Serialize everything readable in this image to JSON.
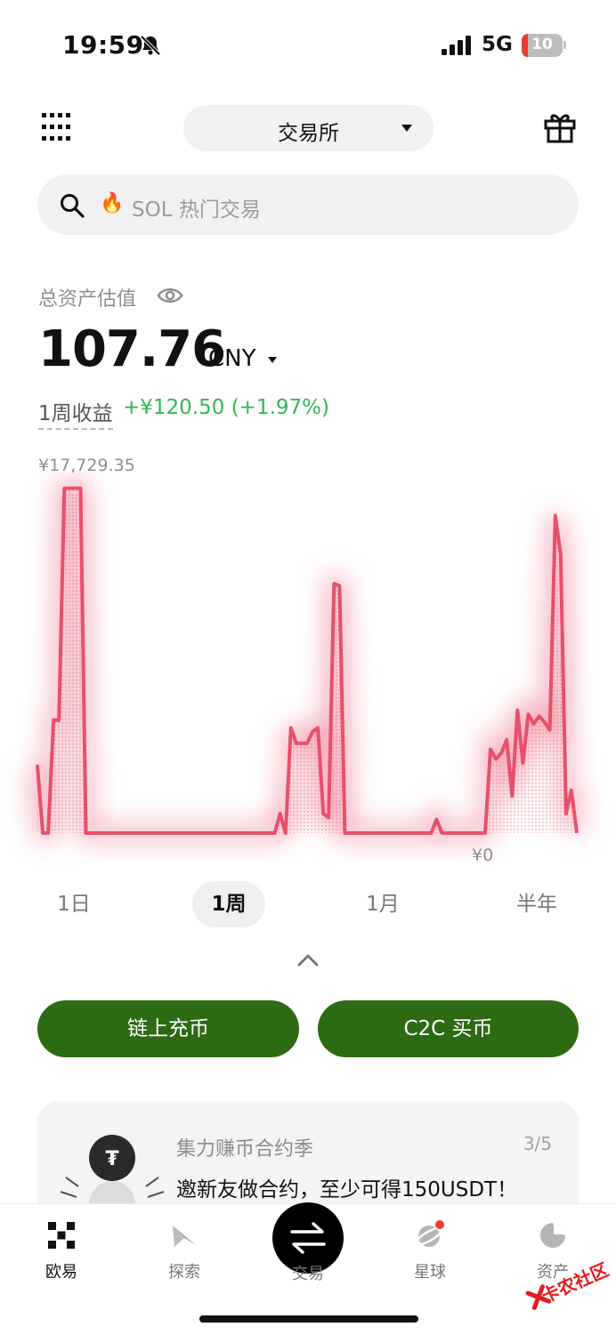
{
  "status_bar": {
    "time": "19:59",
    "network": "5G",
    "battery_level": "10"
  },
  "header": {
    "exchange_label": "交易所"
  },
  "search": {
    "placeholder": "SOL 热门交易",
    "hot_emoji": "🔥"
  },
  "assets": {
    "label": "总资产估值",
    "value": "107.76",
    "currency": "CNY",
    "pnl_label": "1周收益",
    "pnl_value": "+¥120.50 (+1.97%)"
  },
  "chart_data": {
    "type": "line",
    "max_label": "¥17,729.35",
    "min_label": "¥0",
    "ylim": [
      0,
      17729.35
    ],
    "color": "#e8506a",
    "x": [
      0,
      1,
      2,
      3,
      4,
      5,
      6,
      7,
      8,
      9,
      10,
      11,
      12,
      13,
      14,
      15,
      16,
      17,
      18,
      19,
      20,
      21,
      22,
      23,
      24,
      25,
      26,
      27,
      28,
      29,
      30,
      31,
      32,
      33,
      34,
      35,
      36,
      37,
      38,
      39,
      40,
      41,
      42,
      43,
      44,
      45,
      46,
      47,
      48,
      49,
      50,
      51,
      52,
      53,
      54,
      55,
      56,
      57,
      58,
      59,
      60,
      61,
      62,
      63,
      64,
      65,
      66,
      67,
      68,
      69,
      70,
      71,
      72,
      73,
      74,
      75,
      76,
      77,
      78,
      79,
      80,
      81,
      82,
      83,
      84,
      85,
      86,
      87,
      88,
      89,
      90,
      91,
      92,
      93,
      94,
      95,
      96,
      97,
      98,
      99,
      100
    ],
    "values": [
      3500,
      0,
      0,
      5800,
      5800,
      17700,
      17700,
      17700,
      17700,
      0,
      0,
      0,
      0,
      0,
      0,
      0,
      0,
      0,
      0,
      0,
      0,
      0,
      0,
      0,
      0,
      0,
      0,
      0,
      0,
      0,
      0,
      0,
      0,
      0,
      0,
      0,
      0,
      0,
      0,
      0,
      0,
      0,
      0,
      0,
      0,
      1000,
      0,
      5400,
      4600,
      4600,
      4600,
      5200,
      5400,
      1000,
      800,
      12800,
      12700,
      0,
      0,
      0,
      0,
      0,
      0,
      0,
      0,
      0,
      0,
      0,
      0,
      0,
      0,
      0,
      0,
      0,
      700,
      0,
      0,
      0,
      0,
      0,
      0,
      0,
      0,
      0,
      4300,
      3800,
      4100,
      4800,
      1900,
      6300,
      3600,
      6100,
      5600,
      6000,
      5700,
      5300,
      16300,
      14300,
      1000,
      2200,
      0
    ]
  },
  "time_range": {
    "tabs": [
      "1日",
      "1周",
      "1月",
      "半年"
    ],
    "active": "1周"
  },
  "actions": {
    "onchain_deposit": "链上充币",
    "c2c_buy": "C2C 买币"
  },
  "promo": {
    "title": "集力赚币合约季",
    "pager": "3/5",
    "desc": "邀新友做合约，至少可得150USDT！"
  },
  "tabbar": {
    "home": "欧易",
    "explore": "探索",
    "trade": "交易",
    "planet": "星球",
    "assets": "资产"
  },
  "watermark": {
    "text": "卡农社区"
  }
}
